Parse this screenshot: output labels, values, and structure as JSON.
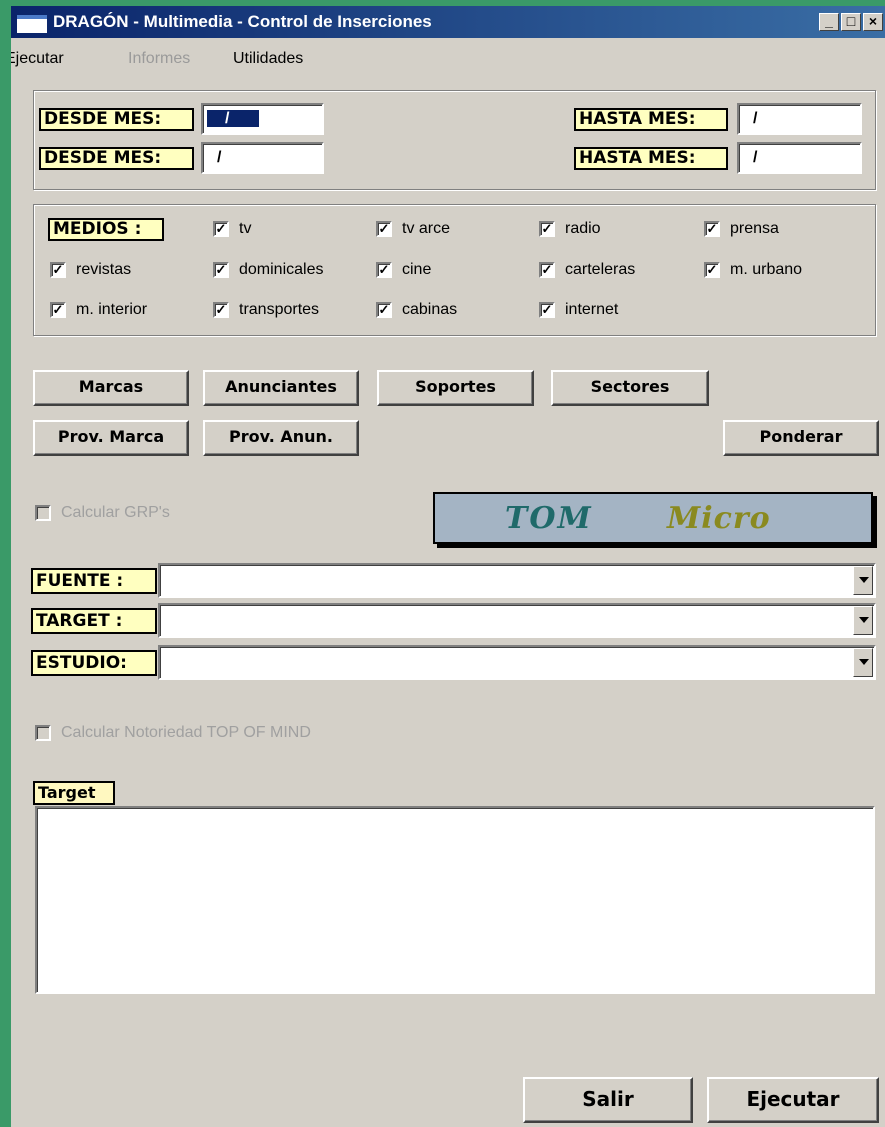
{
  "window": {
    "title": "DRAGÓN - Multimedia - Control de Inserciones",
    "minimize": "_",
    "maximize": "□",
    "close": "×"
  },
  "menu": {
    "ejecutar": "Ejecutar",
    "informes": "Informes",
    "utilidades": "Utilidades"
  },
  "dates": {
    "desde_label": "DESDE MES:",
    "hasta_label": "HASTA MES:",
    "desde1": "/",
    "desde2": "/",
    "hasta1": "/",
    "hasta2": "/"
  },
  "medios": {
    "label": "MEDIOS :",
    "items": [
      {
        "label": "tv",
        "checked": true
      },
      {
        "label": "tv arce",
        "checked": true
      },
      {
        "label": "radio",
        "checked": true
      },
      {
        "label": "prensa",
        "checked": true
      },
      {
        "label": "revistas",
        "checked": true
      },
      {
        "label": "dominicales",
        "checked": true
      },
      {
        "label": "cine",
        "checked": true
      },
      {
        "label": "carteleras",
        "checked": true
      },
      {
        "label": "m. urbano",
        "checked": true
      },
      {
        "label": "m. interior",
        "checked": true
      },
      {
        "label": "transportes",
        "checked": true
      },
      {
        "label": "cabinas",
        "checked": true
      },
      {
        "label": "internet",
        "checked": true
      }
    ]
  },
  "buttons": {
    "marcas": "Marcas",
    "anunciantes": "Anunciantes",
    "soportes": "Soportes",
    "sectores": "Sectores",
    "prov_marca": "Prov. Marca",
    "prov_anun": "Prov. Anun.",
    "ponderar": "Ponderar",
    "salir": "Salir",
    "ejecutar": "Ejecutar"
  },
  "grp": {
    "label": "Calcular GRP's",
    "checked": false,
    "enabled": false
  },
  "logo": {
    "part1": "TOM",
    "part2": "Micro"
  },
  "combos": {
    "fuente_label": "FUENTE :",
    "target_label": "TARGET :",
    "estudio_label": "ESTUDIO:",
    "fuente_value": "",
    "target_value": "",
    "estudio_value": ""
  },
  "notoriedad": {
    "label": "Calcular Notoriedad TOP OF MIND",
    "checked": false,
    "enabled": false
  },
  "target_box": {
    "label": "Target",
    "value": ""
  }
}
